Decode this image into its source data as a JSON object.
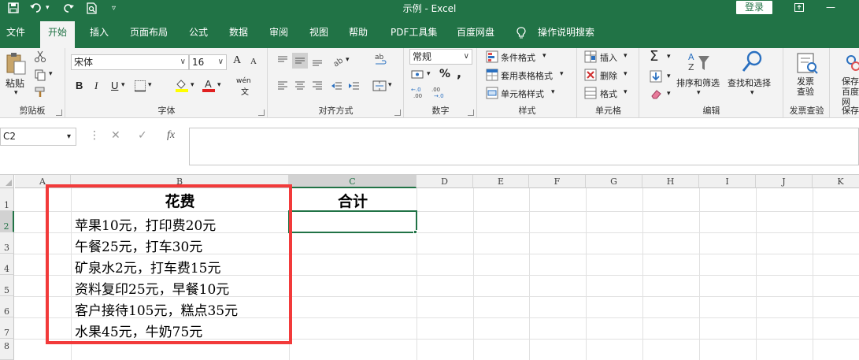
{
  "window": {
    "title": "示例  -  Excel",
    "login_label": "登录",
    "minimize": "—",
    "restore": "❐",
    "close": "✕"
  },
  "tabs": [
    {
      "label": "文件"
    },
    {
      "label": "开始"
    },
    {
      "label": "插入"
    },
    {
      "label": "页面布局"
    },
    {
      "label": "公式"
    },
    {
      "label": "数据"
    },
    {
      "label": "审阅"
    },
    {
      "label": "视图"
    },
    {
      "label": "帮助"
    },
    {
      "label": "PDF工具集"
    },
    {
      "label": "百度网盘"
    },
    {
      "label": "操作说明搜索"
    }
  ],
  "ribbon": {
    "clipboard": {
      "label": "剪贴板",
      "paste": "粘贴"
    },
    "font": {
      "label": "字体",
      "name": "宋体",
      "size": "16",
      "bold": "B",
      "italic": "I",
      "underline": "U",
      "grow": "A",
      "shrink": "A",
      "wen": "wén"
    },
    "alignment": {
      "label": "对齐方式"
    },
    "number": {
      "label": "数字",
      "format": "常规",
      "percent": "%",
      "comma": ","
    },
    "styles": {
      "label": "样式",
      "conditional": "条件格式",
      "table": "套用表格格式",
      "cell": "单元格样式"
    },
    "cells": {
      "label": "单元格",
      "insert": "插入",
      "delete": "删除",
      "format": "格式"
    },
    "editing": {
      "label": "编辑",
      "sort": "排序和筛选",
      "find": "查找和选择"
    },
    "invoice": {
      "label": "发票查验",
      "button": "发票\n查验"
    },
    "save": {
      "label": "保存",
      "button": "保存\n百度网"
    }
  },
  "formula_bar": {
    "name_box": "C2",
    "cancel": "✕",
    "enter": "✓",
    "fx": "fx",
    "value": ""
  },
  "grid": {
    "columns": [
      "A",
      "B",
      "C",
      "D",
      "E",
      "F",
      "G",
      "H",
      "I",
      "J",
      "K"
    ],
    "rows": [
      "1",
      "2",
      "3",
      "4",
      "5",
      "6",
      "7",
      "8"
    ],
    "cells": {
      "B1": "花费",
      "C1": "合计",
      "B2": "苹果10元，打印费20元",
      "B3": "午餐25元，打车30元",
      "B4": "矿泉水2元，打车费15元",
      "B5": "资料复印25元，早餐10元",
      "B6": "客户接待105元，糕点35元",
      "B7": "水果45元，牛奶75元"
    },
    "selected_cell": "C2",
    "highlight_color": "#f23a3a",
    "accent_color": "#217346"
  }
}
